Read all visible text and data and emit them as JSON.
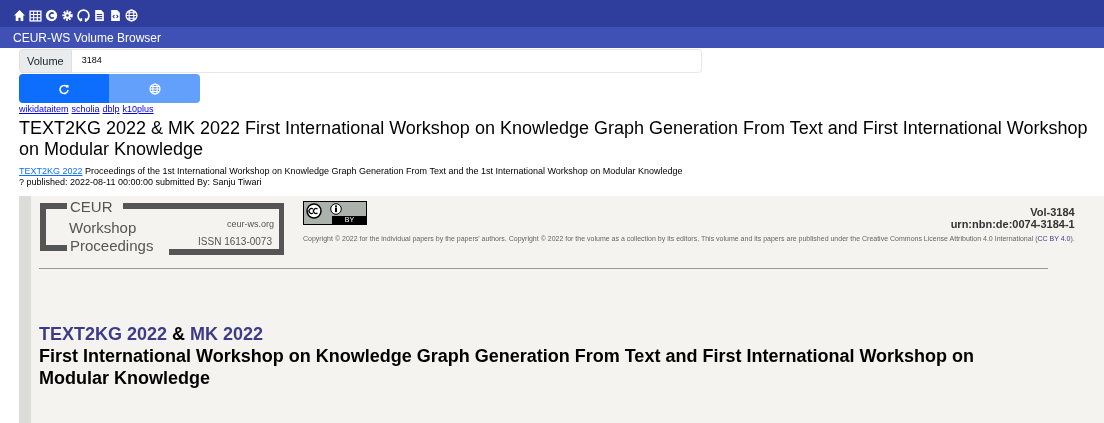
{
  "app_title": "CEUR-WS Volume Browser",
  "volume_field": {
    "label": "Volume",
    "value": "3184"
  },
  "buttons": [
    {
      "selected": true
    },
    {
      "selected": false
    }
  ],
  "links": [
    "wikidataitem",
    "scholia",
    "dblp",
    "k10plus"
  ],
  "heading": "TEXT2KG 2022 & MK 2022 First International Workshop on Knowledge Graph Generation From Text and First International Workshop on Modular Knowledge",
  "proceedings_link": "TEXT2KG 2022",
  "proceedings_text": "Proceedings of the 1st International Workshop on Knowledge Graph Generation From Text and the 1st International Workshop on Modular Knowledge",
  "published_line": "? published: 2022-08-11 00:00:00 submitted By: Sanju Tiwari",
  "ceur_page": {
    "logo": {
      "words": [
        "CEUR",
        "Workshop",
        "Proceedings"
      ],
      "site": "ceur-ws.org",
      "issn": "ISSN 1613-0073"
    },
    "license_badge": {
      "label": "BY"
    },
    "copyright_before": "Copyright © 2022 for the individual papers by the papers' authors. Copyright © 2022 for the volume as a collection by its editors. This volume and its papers are published under the Creative Commons License Attribution 4.0 International (",
    "license_link": "CC BY 4.0",
    "copyright_after": ").",
    "volume_number": "Vol-3184",
    "urn": "urn:nbn:de:0074-3184-1",
    "acronyms": [
      "TEXT2KG 2022",
      "MK 2022"
    ],
    "acronym_separator": "&",
    "title": "First International Workshop on Knowledge Graph Generation From Text and First International Workshop on Modular Knowledge"
  }
}
